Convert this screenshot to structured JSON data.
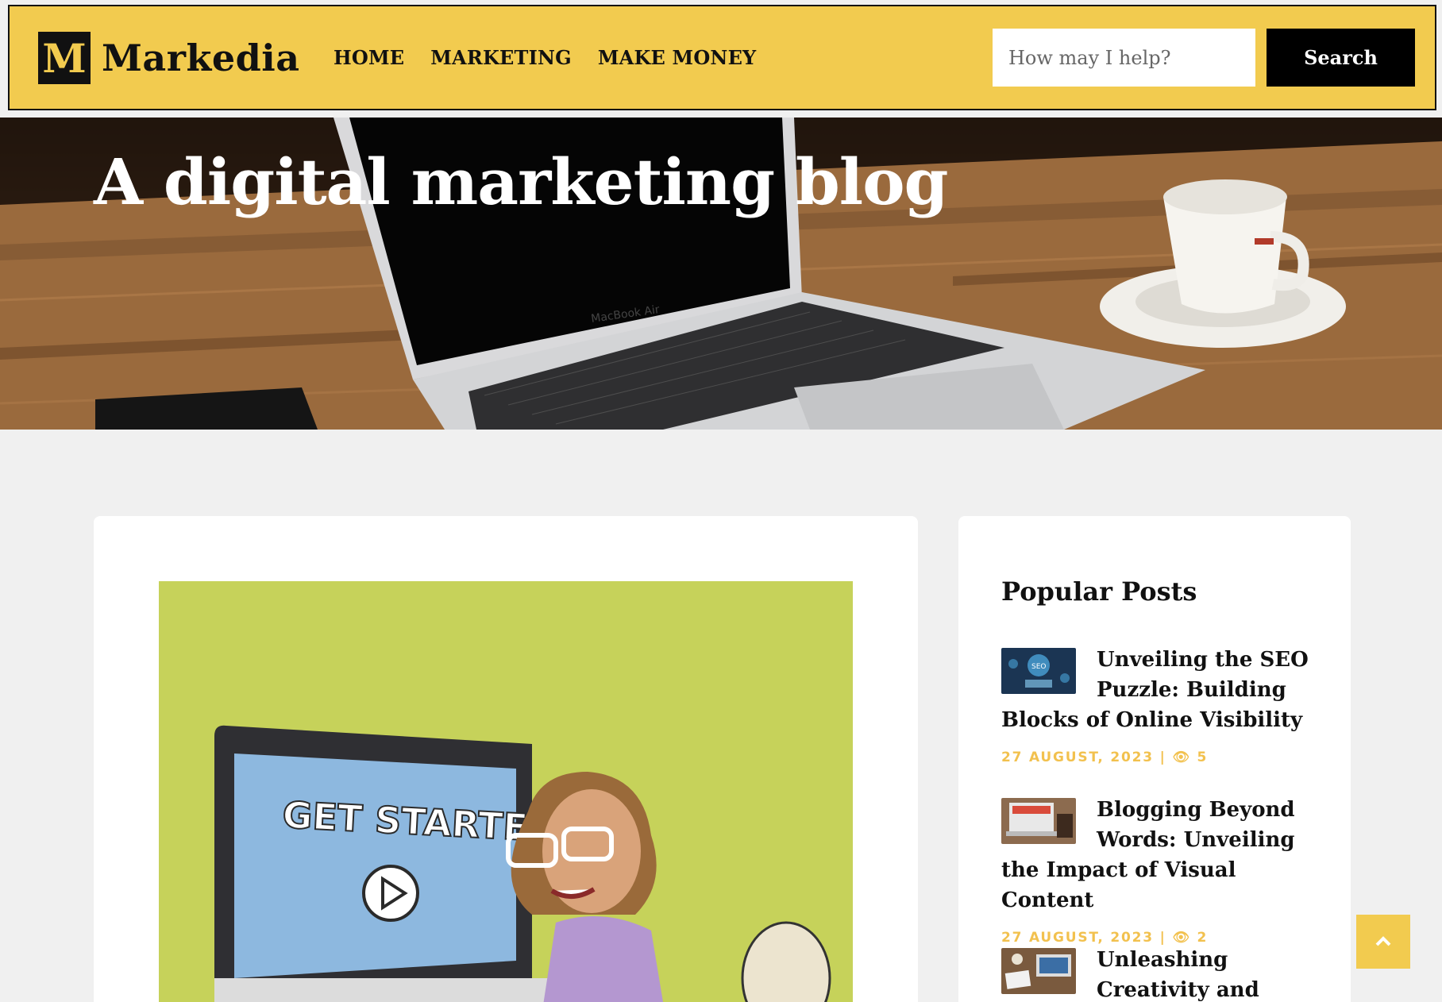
{
  "brand": {
    "mark": "M",
    "name": "Markedia"
  },
  "nav": [
    "HOME",
    "MARKETING",
    "MAKE MONEY"
  ],
  "search": {
    "placeholder": "How may I help?",
    "button": "Search"
  },
  "hero": {
    "title": "A digital marketing blog",
    "laptop_label": "MacBook Air"
  },
  "article_image": {
    "screen_text": "GET STARTED"
  },
  "sidebar": {
    "title": "Popular Posts",
    "posts": [
      {
        "title": "Unveiling the SEO Puzzle: Building Blocks of Online Visibility",
        "date": "27 AUGUST, 2023",
        "views": "5",
        "thumb_icon": "seo-thumbnail"
      },
      {
        "title": "Blogging Beyond Words: Unveiling the Impact of Visual Content",
        "date": "27 AUGUST, 2023",
        "views": "2",
        "thumb_icon": "blogging-thumbnail"
      },
      {
        "title": "Unleashing Creativity and",
        "date": "",
        "views": "",
        "thumb_icon": "workspace-thumbnail"
      }
    ]
  },
  "colors": {
    "accent": "#f2cb4f",
    "meta": "#f2c14e",
    "dark": "#111111",
    "image_bg": "#c6d25a"
  }
}
